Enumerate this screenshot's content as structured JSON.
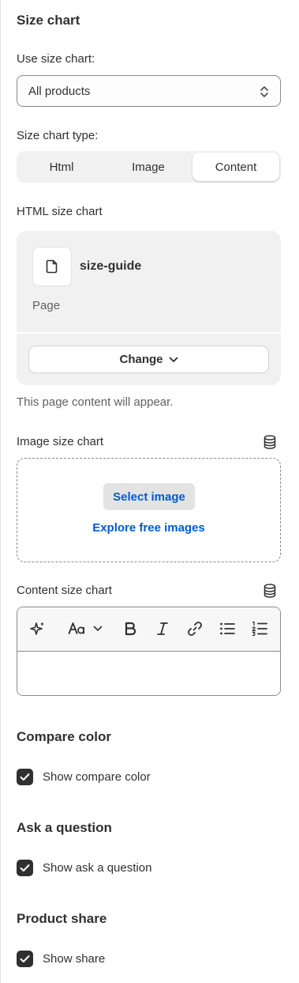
{
  "size_chart": {
    "title": "Size chart",
    "use_label": "Use size chart:",
    "use_value": "All products",
    "type_label": "Size chart type:",
    "types": [
      "Html",
      "Image",
      "Content"
    ],
    "active_type": "Content"
  },
  "html_chart": {
    "label": "HTML size chart",
    "page_name": "size-guide",
    "page_type": "Page",
    "change_label": "Change",
    "hint": "This page content will appear."
  },
  "image_chart": {
    "label": "Image size chart",
    "select_label": "Select image",
    "explore_label": "Explore free images"
  },
  "content_chart": {
    "label": "Content size chart",
    "toolbar": [
      "magic-icon",
      "text-format-icon",
      "bold-icon",
      "italic-icon",
      "link-icon",
      "bullet-list-icon",
      "numbered-list-icon"
    ],
    "value": ""
  },
  "compare_color": {
    "title": "Compare color",
    "checkbox_label": "Show compare color",
    "checked": true
  },
  "ask_question": {
    "title": "Ask a question",
    "checkbox_label": "Show ask a question",
    "checked": true
  },
  "product_share": {
    "title": "Product share",
    "checkbox_label": "Show share",
    "checked": true
  },
  "colors": {
    "link": "#005bd3",
    "checkbox": "#303030",
    "text": "#303030"
  }
}
